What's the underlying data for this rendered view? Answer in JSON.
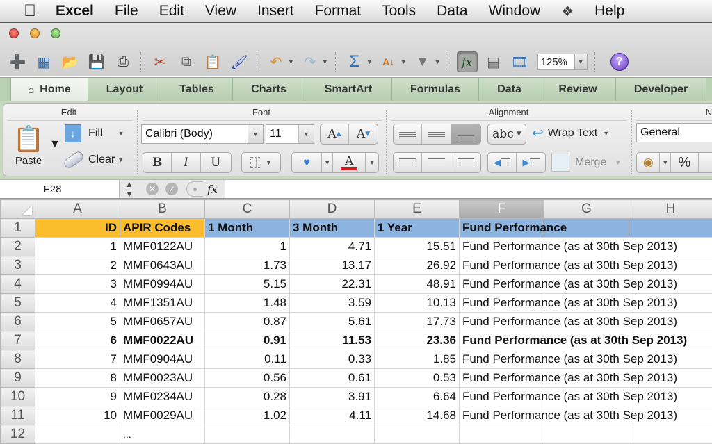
{
  "menubar": {
    "app": "Excel",
    "items": [
      "File",
      "Edit",
      "View",
      "Insert",
      "Format",
      "Tools",
      "Data",
      "Window",
      "Help"
    ]
  },
  "toolbar": {
    "icons": [
      "new-workbook",
      "templates-gallery",
      "open",
      "save",
      "print",
      "cut",
      "copy",
      "paste",
      "format-painter",
      "undo",
      "redo",
      "autosum",
      "sort",
      "filter",
      "formula-builder",
      "toolbox",
      "media-browser"
    ],
    "zoom": "125%"
  },
  "ribbon": {
    "tabs": [
      "Home",
      "Layout",
      "Tables",
      "Charts",
      "SmartArt",
      "Formulas",
      "Data",
      "Review",
      "Developer"
    ],
    "active_tab": "Home",
    "edit": {
      "title": "Edit",
      "paste": "Paste",
      "fill": "Fill",
      "clear": "Clear"
    },
    "font": {
      "title": "Font",
      "font_name": "Calibri (Body)",
      "font_size": "11",
      "bold": "B",
      "italic": "I",
      "underline": "U",
      "font_color": "#e0141e"
    },
    "alignment": {
      "title": "Alignment",
      "orientation": "abc",
      "wrap_text": "Wrap Text",
      "merge": "Merge"
    },
    "number": {
      "title": "Nu",
      "format": "General",
      "percent": "%"
    }
  },
  "formula_bar": {
    "name_box": "F28",
    "fx": "fx",
    "value": ""
  },
  "sheet": {
    "columns": [
      "A",
      "B",
      "C",
      "D",
      "E",
      "F",
      "G",
      "H"
    ],
    "selected_column": "F",
    "header_row": {
      "row": "1",
      "cells": [
        "ID",
        "APIR Codes",
        "1 Month",
        "3 Month",
        "1 Year",
        "Fund Performance"
      ]
    },
    "rows": [
      {
        "row": "2",
        "id": "1",
        "apir": "MMF0122AU",
        "m1": "1",
        "m3": "4.71",
        "y1": "15.51",
        "perf": "Fund Performance (as at 30th Sep 2013)",
        "bold": false
      },
      {
        "row": "3",
        "id": "2",
        "apir": "MMF0643AU",
        "m1": "1.73",
        "m3": "13.17",
        "y1": "26.92",
        "perf": "Fund Performance (as at 30th Sep 2013)",
        "bold": false
      },
      {
        "row": "4",
        "id": "3",
        "apir": "MMF0994AU",
        "m1": "5.15",
        "m3": "22.31",
        "y1": "48.91",
        "perf": "Fund Performance (as at 30th Sep 2013)",
        "bold": false
      },
      {
        "row": "5",
        "id": "4",
        "apir": "MMF1351AU",
        "m1": "1.48",
        "m3": "3.59",
        "y1": "10.13",
        "perf": "Fund Performance (as at 30th Sep 2013)",
        "bold": false
      },
      {
        "row": "6",
        "id": "5",
        "apir": "MMF0657AU",
        "m1": "0.87",
        "m3": "5.61",
        "y1": "17.73",
        "perf": "Fund Performance (as at 30th Sep 2013)",
        "bold": false
      },
      {
        "row": "7",
        "id": "6",
        "apir": "MMF0022AU",
        "m1": "0.91",
        "m3": "11.53",
        "y1": "23.36",
        "perf": "Fund Performance (as at 30th Sep 2013)",
        "bold": true
      },
      {
        "row": "8",
        "id": "7",
        "apir": "MMF0904AU",
        "m1": "0.11",
        "m3": "0.33",
        "y1": "1.85",
        "perf": "Fund Performance (as at 30th Sep 2013)",
        "bold": false
      },
      {
        "row": "9",
        "id": "8",
        "apir": "MMF0023AU",
        "m1": "0.56",
        "m3": "0.61",
        "y1": "0.53",
        "perf": "Fund Performance (as at 30th Sep 2013)",
        "bold": false
      },
      {
        "row": "10",
        "id": "9",
        "apir": "MMF0234AU",
        "m1": "0.28",
        "m3": "3.91",
        "y1": "6.64",
        "perf": "Fund Performance (as at 30th Sep 2013)",
        "bold": false
      },
      {
        "row": "11",
        "id": "10",
        "apir": "MMF0029AU",
        "m1": "1.02",
        "m3": "4.11",
        "y1": "14.68",
        "perf": "Fund Performance (as at 30th Sep 2013)",
        "bold": false
      }
    ],
    "last_row": {
      "row": "12",
      "b": "..."
    },
    "colors": {
      "orange_header": "#fbbd2c",
      "blue_header": "#8db3e0"
    }
  }
}
